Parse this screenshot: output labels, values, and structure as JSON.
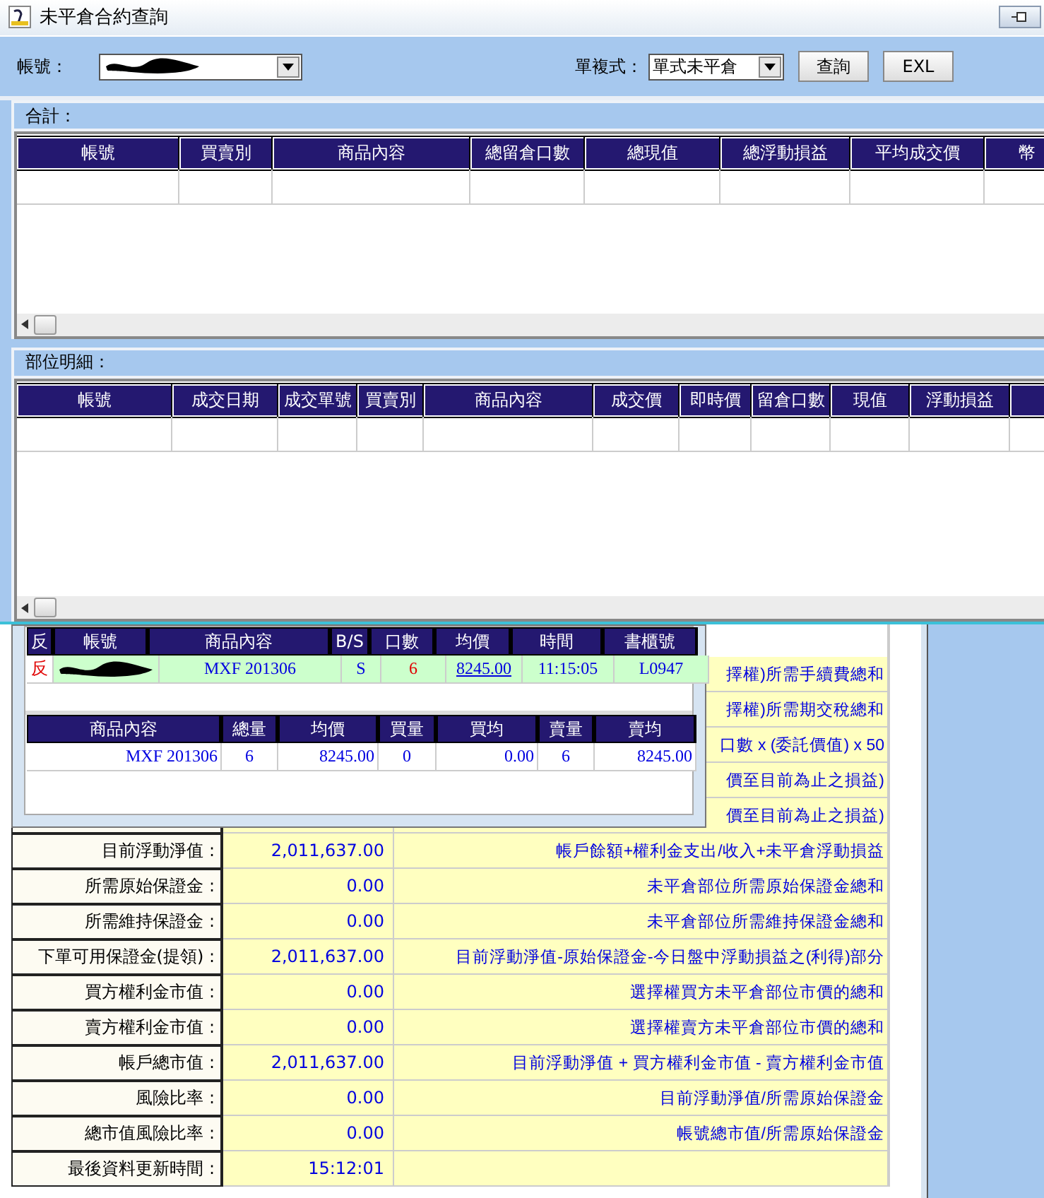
{
  "window": {
    "title": "未平倉合約查詢"
  },
  "filters": {
    "account_label": "帳號：",
    "type_label": "單複式：",
    "type_value": "單式未平倉",
    "buttons": [
      "查詢",
      "EXL"
    ]
  },
  "summary": {
    "title": "合計：",
    "columns": [
      "帳號",
      "買賣別",
      "商品內容",
      "總留倉口數",
      "總現值",
      "總浮動損益",
      "平均成交價",
      "幣"
    ]
  },
  "positions": {
    "title": "部位明細：",
    "columns": [
      "帳號",
      "成交日期",
      "成交單號",
      "買賣別",
      "商品內容",
      "成交價",
      "即時價",
      "留倉口數",
      "現值",
      "浮動損益"
    ]
  },
  "order_popup": {
    "orders": {
      "columns": [
        "反",
        "帳號",
        "商品內容",
        "B/S",
        "口數",
        "均價",
        "時間",
        "書櫃號"
      ],
      "rows": [
        {
          "mark": "反",
          "product": "MXF 201306",
          "side": "S",
          "qty": "6",
          "avg_price": "8245.00",
          "time": "11:15:05",
          "counter": "L0947"
        }
      ]
    },
    "totals": {
      "columns": [
        "商品內容",
        "總量",
        "均價",
        "買量",
        "買均",
        "賣量",
        "賣均"
      ],
      "rows": [
        {
          "cells": [
            "MXF 201306",
            "6",
            "8245.00",
            "0",
            "0.00",
            "6",
            "8245.00"
          ]
        }
      ]
    }
  },
  "margin": {
    "partial_formulas": [
      "擇權)所需手續費總和",
      "擇權)所需期交稅總和",
      "口數 x (委託價值) x 50",
      "價至目前為止之損益)",
      "價至目前為止之損益)"
    ],
    "rows": [
      {
        "label": "目前浮動淨值 :",
        "value": "2,011,637.00",
        "formula": "帳戶餘額+權利金支出/收入+未平倉浮動損益"
      },
      {
        "label": "所需原始保證金 :",
        "value": "0.00",
        "formula": "未平倉部位所需原始保證金總和"
      },
      {
        "label": "所需維持保證金 :",
        "value": "0.00",
        "formula": "未平倉部位所需維持保證金總和"
      },
      {
        "label": "下單可用保證金(提領) :",
        "value": "2,011,637.00",
        "formula": "目前浮動淨值-原始保證金-今日盤中浮動損益之(利得)部分"
      },
      {
        "label": "買方權利金市值 :",
        "value": "0.00",
        "formula": "選擇權買方未平倉部位市價的總和"
      },
      {
        "label": "賣方權利金市值 :",
        "value": "0.00",
        "formula": "選擇權賣方未平倉部位市價的總和"
      },
      {
        "label": "帳戶總市值 :",
        "value": "2,011,637.00",
        "formula": "目前浮動淨值 + 買方權利金市值 - 賣方權利金市值"
      },
      {
        "label": "風險比率 :",
        "value": "0.00",
        "formula": "目前浮動淨值/所需原始保證金"
      },
      {
        "label": "總市值風險比率 :",
        "value": "0.00",
        "formula": "帳號總市值/所需原始保證金"
      },
      {
        "label": "最後資料更新時間 :",
        "value": "15:12:01"
      }
    ]
  }
}
